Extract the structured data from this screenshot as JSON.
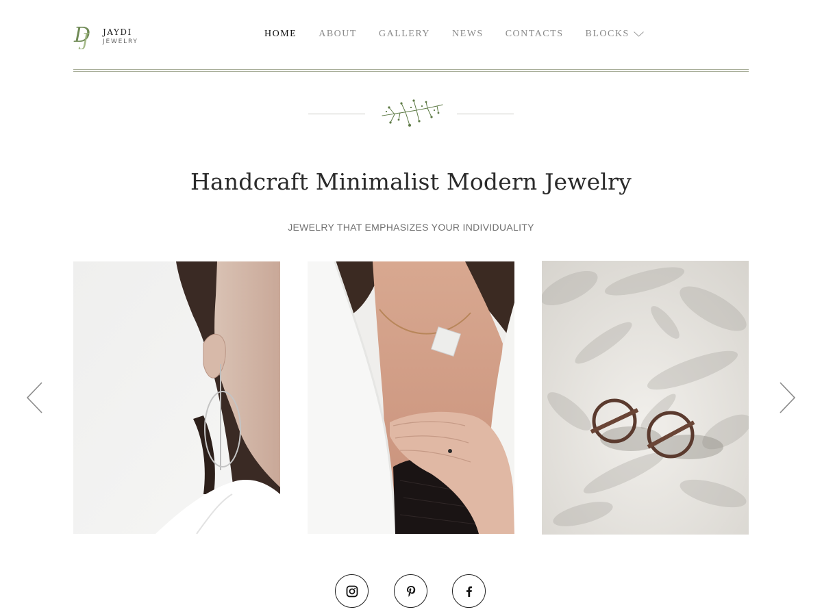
{
  "brand": {
    "name": "JAYDI",
    "sub": "JEWELRY",
    "monogram": "DJ",
    "accent": "#7e9a5e"
  },
  "nav": {
    "items": [
      {
        "label": "HOME",
        "active": true
      },
      {
        "label": "ABOUT",
        "active": false
      },
      {
        "label": "GALLERY",
        "active": false
      },
      {
        "label": "NEWS",
        "active": false
      },
      {
        "label": "CONTACTS",
        "active": false
      },
      {
        "label": "BLOCKS",
        "active": false,
        "icon": "chevron-down-icon"
      }
    ]
  },
  "hero": {
    "title": "Handcraft Minimalist Modern Jewelry",
    "subtitle": "JEWELRY THAT EMPHASIZES YOUR INDIVIDUALITY"
  },
  "gallery": {
    "photos": [
      {
        "subject": "earring"
      },
      {
        "subject": "necklace"
      },
      {
        "subject": "rings"
      }
    ],
    "prev_icon": "chevron-left-icon",
    "next_icon": "chevron-right-icon"
  },
  "social": [
    {
      "icon": "instagram-icon"
    },
    {
      "icon": "pinterest-icon"
    },
    {
      "icon": "facebook-icon"
    }
  ],
  "colors": {
    "rule": "#a8ae99",
    "text_dark": "#2a2a2a",
    "text_muted": "#8a8a8a",
    "ornament": "#5d7a45"
  }
}
